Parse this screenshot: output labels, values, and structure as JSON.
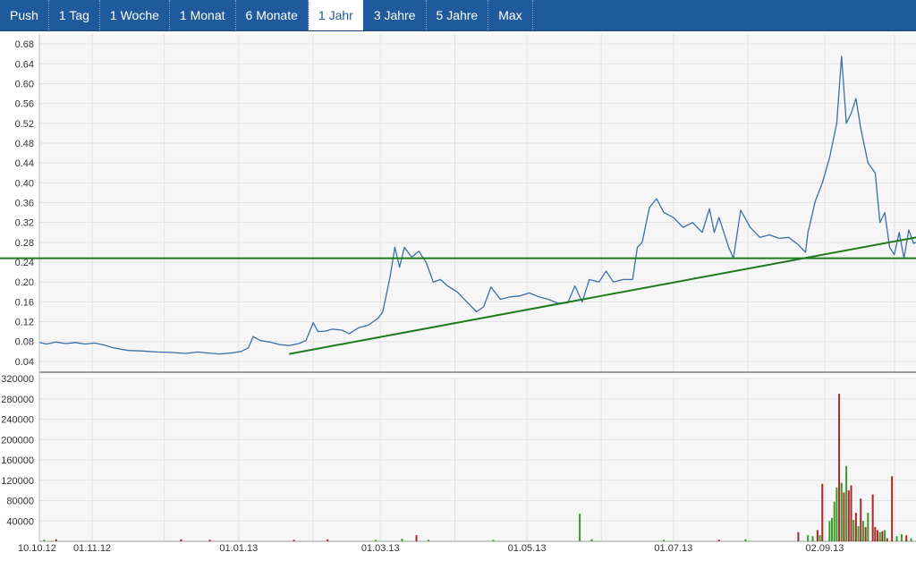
{
  "tabs": [
    {
      "label": "Push",
      "active": false
    },
    {
      "label": "1 Tag",
      "active": false
    },
    {
      "label": "1 Woche",
      "active": false
    },
    {
      "label": "1 Monat",
      "active": false
    },
    {
      "label": "6 Monate",
      "active": false
    },
    {
      "label": "1 Jahr",
      "active": true
    },
    {
      "label": "3 Jahre",
      "active": false
    },
    {
      "label": "5 Jahre",
      "active": false
    },
    {
      "label": "Max",
      "active": false
    }
  ],
  "colors": {
    "price_line": "#3a6fa8",
    "trend_line": "#1f7a1f",
    "volume_up": "#3a9a2a",
    "volume_down": "#a52a2a",
    "grid": "#e2e2e2",
    "plot_bg": "#f6f6f6"
  },
  "chart_data": [
    {
      "type": "line",
      "title": "",
      "ylim": [
        0.02,
        0.7
      ],
      "yticks": [
        0.04,
        0.08,
        0.12,
        0.16,
        0.2,
        0.24,
        0.28,
        0.32,
        0.36,
        0.4,
        0.44,
        0.48,
        0.52,
        0.56,
        0.6,
        0.64,
        0.68
      ],
      "ytick_labels": [
        "0.04",
        "0.08",
        "0.12",
        "0.16",
        "0.20",
        "0.24",
        "0.28",
        "0.32",
        "0.36",
        "0.40",
        "0.44",
        "0.48",
        "0.52",
        "0.56",
        "0.60",
        "0.64",
        "0.68"
      ],
      "xlim": [
        "2012-10-10",
        "2013-10-10"
      ],
      "xticks": [
        {
          "date": "2012-10-10",
          "label": "10.10.12"
        },
        {
          "date": "2012-11-01",
          "label": "01.11.12"
        },
        {
          "date": "2013-01-01",
          "label": "01.01.13"
        },
        {
          "date": "2013-03-01",
          "label": "01.03.13"
        },
        {
          "date": "2013-05-01",
          "label": "01.05.13"
        },
        {
          "date": "2013-07-01",
          "label": "01.07.13"
        },
        {
          "date": "2013-09-02",
          "label": "02.09.13"
        }
      ],
      "grid": true,
      "series": [
        {
          "values": [
            [
              "2012-10-10",
              0.078
            ],
            [
              "2012-10-13",
              0.075
            ],
            [
              "2012-10-17",
              0.079
            ],
            [
              "2012-10-21",
              0.076
            ],
            [
              "2012-10-25",
              0.078
            ],
            [
              "2012-10-29",
              0.075
            ],
            [
              "2012-11-02",
              0.077
            ],
            [
              "2012-11-06",
              0.073
            ],
            [
              "2012-11-10",
              0.067
            ],
            [
              "2012-11-16",
              0.062
            ],
            [
              "2012-11-22",
              0.061
            ],
            [
              "2012-11-28",
              0.059
            ],
            [
              "2012-12-04",
              0.058
            ],
            [
              "2012-12-10",
              0.056
            ],
            [
              "2012-12-15",
              0.059
            ],
            [
              "2012-12-19",
              0.057
            ],
            [
              "2012-12-24",
              0.055
            ],
            [
              "2012-12-29",
              0.057
            ],
            [
              "2013-01-02",
              0.06
            ],
            [
              "2013-01-05",
              0.067
            ],
            [
              "2013-01-07",
              0.09
            ],
            [
              "2013-01-10",
              0.082
            ],
            [
              "2013-01-14",
              0.079
            ],
            [
              "2013-01-18",
              0.074
            ],
            [
              "2013-01-22",
              0.072
            ],
            [
              "2013-01-26",
              0.076
            ],
            [
              "2013-01-29",
              0.082
            ],
            [
              "2013-02-01",
              0.118
            ],
            [
              "2013-02-03",
              0.1
            ],
            [
              "2013-02-06",
              0.101
            ],
            [
              "2013-02-09",
              0.105
            ],
            [
              "2013-02-13",
              0.103
            ],
            [
              "2013-02-16",
              0.096
            ],
            [
              "2013-02-20",
              0.108
            ],
            [
              "2013-02-24",
              0.113
            ],
            [
              "2013-02-28",
              0.127
            ],
            [
              "2013-03-02",
              0.14
            ],
            [
              "2013-03-05",
              0.21
            ],
            [
              "2013-03-07",
              0.27
            ],
            [
              "2013-03-09",
              0.23
            ],
            [
              "2013-03-11",
              0.27
            ],
            [
              "2013-03-14",
              0.25
            ],
            [
              "2013-03-17",
              0.262
            ],
            [
              "2013-03-20",
              0.24
            ],
            [
              "2013-03-23",
              0.2
            ],
            [
              "2013-03-26",
              0.205
            ],
            [
              "2013-03-29",
              0.192
            ],
            [
              "2013-04-02",
              0.18
            ],
            [
              "2013-04-06",
              0.16
            ],
            [
              "2013-04-10",
              0.14
            ],
            [
              "2013-04-13",
              0.15
            ],
            [
              "2013-04-16",
              0.19
            ],
            [
              "2013-04-20",
              0.165
            ],
            [
              "2013-04-24",
              0.17
            ],
            [
              "2013-04-28",
              0.172
            ],
            [
              "2013-05-02",
              0.178
            ],
            [
              "2013-05-06",
              0.17
            ],
            [
              "2013-05-10",
              0.165
            ],
            [
              "2013-05-14",
              0.157
            ],
            [
              "2013-05-18",
              0.158
            ],
            [
              "2013-05-21",
              0.192
            ],
            [
              "2013-05-24",
              0.16
            ],
            [
              "2013-05-27",
              0.205
            ],
            [
              "2013-05-31",
              0.2
            ],
            [
              "2013-06-03",
              0.222
            ],
            [
              "2013-06-06",
              0.2
            ],
            [
              "2013-06-10",
              0.205
            ],
            [
              "2013-06-14",
              0.205
            ],
            [
              "2013-06-16",
              0.27
            ],
            [
              "2013-06-18",
              0.28
            ],
            [
              "2013-06-21",
              0.35
            ],
            [
              "2013-06-24",
              0.368
            ],
            [
              "2013-06-27",
              0.34
            ],
            [
              "2013-07-01",
              0.33
            ],
            [
              "2013-07-05",
              0.31
            ],
            [
              "2013-07-09",
              0.32
            ],
            [
              "2013-07-13",
              0.3
            ],
            [
              "2013-07-16",
              0.348
            ],
            [
              "2013-07-18",
              0.3
            ],
            [
              "2013-07-20",
              0.33
            ],
            [
              "2013-07-24",
              0.27
            ],
            [
              "2013-07-26",
              0.248
            ],
            [
              "2013-07-29",
              0.345
            ],
            [
              "2013-08-02",
              0.31
            ],
            [
              "2013-08-06",
              0.29
            ],
            [
              "2013-08-10",
              0.295
            ],
            [
              "2013-08-14",
              0.288
            ],
            [
              "2013-08-18",
              0.29
            ],
            [
              "2013-08-22",
              0.275
            ],
            [
              "2013-08-25",
              0.26
            ],
            [
              "2013-08-26",
              0.3
            ],
            [
              "2013-08-27",
              0.32
            ],
            [
              "2013-08-29",
              0.362
            ],
            [
              "2013-09-01",
              0.4
            ],
            [
              "2013-09-04",
              0.45
            ],
            [
              "2013-09-07",
              0.52
            ],
            [
              "2013-09-09",
              0.655
            ],
            [
              "2013-09-11",
              0.52
            ],
            [
              "2013-09-13",
              0.54
            ],
            [
              "2013-09-15",
              0.57
            ],
            [
              "2013-09-17",
              0.51
            ],
            [
              "2013-09-20",
              0.44
            ],
            [
              "2013-09-23",
              0.42
            ],
            [
              "2013-09-25",
              0.32
            ],
            [
              "2013-09-27",
              0.34
            ],
            [
              "2013-09-29",
              0.27
            ],
            [
              "2013-10-01",
              0.255
            ],
            [
              "2013-10-03",
              0.3
            ],
            [
              "2013-10-05",
              0.248
            ],
            [
              "2013-10-07",
              0.305
            ],
            [
              "2013-10-09",
              0.278
            ],
            [
              "2013-10-10",
              0.28
            ]
          ]
        }
      ],
      "lines": [
        {
          "kind": "horizontal",
          "y": 0.248
        },
        {
          "kind": "trend",
          "from": [
            "2013-01-22",
            0.055
          ],
          "to": [
            "2013-10-10",
            0.29
          ]
        }
      ]
    },
    {
      "type": "bar",
      "title": "",
      "ylim": [
        0,
        320000
      ],
      "yticks": [
        40000,
        80000,
        120000,
        160000,
        200000,
        240000,
        280000,
        320000
      ],
      "ytick_labels": [
        "40000",
        "80000",
        "120000",
        "160000",
        "200000",
        "240000",
        "280000",
        "320000"
      ],
      "grid": true,
      "bars": [
        {
          "date": "2012-10-12",
          "value": 3000,
          "dir": "up"
        },
        {
          "date": "2012-10-17",
          "value": 4000,
          "dir": "down"
        },
        {
          "date": "2012-12-08",
          "value": 4000,
          "dir": "down"
        },
        {
          "date": "2012-12-20",
          "value": 3000,
          "dir": "down"
        },
        {
          "date": "2013-01-24",
          "value": 3000,
          "dir": "down"
        },
        {
          "date": "2013-02-07",
          "value": 4000,
          "dir": "down"
        },
        {
          "date": "2013-02-27",
          "value": 3000,
          "dir": "up"
        },
        {
          "date": "2013-03-10",
          "value": 5000,
          "dir": "up"
        },
        {
          "date": "2013-03-16",
          "value": 12000,
          "dir": "down"
        },
        {
          "date": "2013-03-21",
          "value": 3000,
          "dir": "up"
        },
        {
          "date": "2013-04-17",
          "value": 3000,
          "dir": "up"
        },
        {
          "date": "2013-05-23",
          "value": 54000,
          "dir": "up"
        },
        {
          "date": "2013-05-28",
          "value": 4000,
          "dir": "up"
        },
        {
          "date": "2013-06-27",
          "value": 3000,
          "dir": "up"
        },
        {
          "date": "2013-07-20",
          "value": 3000,
          "dir": "down"
        },
        {
          "date": "2013-07-31",
          "value": 4000,
          "dir": "up"
        },
        {
          "date": "2013-08-22",
          "value": 18000,
          "dir": "down"
        },
        {
          "date": "2013-08-26",
          "value": 12000,
          "dir": "up"
        },
        {
          "date": "2013-08-28",
          "value": 10000,
          "dir": "up"
        },
        {
          "date": "2013-08-30",
          "value": 22000,
          "dir": "down"
        },
        {
          "date": "2013-08-31",
          "value": 12000,
          "dir": "up"
        },
        {
          "date": "2013-09-01",
          "value": 113000,
          "dir": "down"
        },
        {
          "date": "2013-09-04",
          "value": 40000,
          "dir": "up"
        },
        {
          "date": "2013-09-05",
          "value": 46000,
          "dir": "up"
        },
        {
          "date": "2013-09-06",
          "value": 78000,
          "dir": "up"
        },
        {
          "date": "2013-09-07",
          "value": 106000,
          "dir": "up"
        },
        {
          "date": "2013-09-08",
          "value": 290000,
          "dir": "down"
        },
        {
          "date": "2013-09-09",
          "value": 115000,
          "dir": "up"
        },
        {
          "date": "2013-09-10",
          "value": 96000,
          "dir": "down"
        },
        {
          "date": "2013-09-11",
          "value": 148000,
          "dir": "up"
        },
        {
          "date": "2013-09-12",
          "value": 100000,
          "dir": "down"
        },
        {
          "date": "2013-09-13",
          "value": 110000,
          "dir": "down"
        },
        {
          "date": "2013-09-14",
          "value": 42000,
          "dir": "up"
        },
        {
          "date": "2013-09-15",
          "value": 56000,
          "dir": "down"
        },
        {
          "date": "2013-09-16",
          "value": 30000,
          "dir": "up"
        },
        {
          "date": "2013-09-17",
          "value": 84000,
          "dir": "down"
        },
        {
          "date": "2013-09-18",
          "value": 40000,
          "dir": "up"
        },
        {
          "date": "2013-09-19",
          "value": 28000,
          "dir": "down"
        },
        {
          "date": "2013-09-20",
          "value": 56000,
          "dir": "up"
        },
        {
          "date": "2013-09-22",
          "value": 92000,
          "dir": "down"
        },
        {
          "date": "2013-09-23",
          "value": 28000,
          "dir": "down"
        },
        {
          "date": "2013-09-24",
          "value": 22000,
          "dir": "down"
        },
        {
          "date": "2013-09-25",
          "value": 18000,
          "dir": "up"
        },
        {
          "date": "2013-09-26",
          "value": 20000,
          "dir": "down"
        },
        {
          "date": "2013-09-27",
          "value": 22000,
          "dir": "up"
        },
        {
          "date": "2013-09-28",
          "value": 6000,
          "dir": "down"
        },
        {
          "date": "2013-09-30",
          "value": 128000,
          "dir": "down"
        },
        {
          "date": "2013-10-02",
          "value": 10000,
          "dir": "up"
        },
        {
          "date": "2013-10-04",
          "value": 14000,
          "dir": "up"
        },
        {
          "date": "2013-10-06",
          "value": 12000,
          "dir": "down"
        },
        {
          "date": "2013-10-08",
          "value": 6000,
          "dir": "up"
        }
      ]
    }
  ]
}
